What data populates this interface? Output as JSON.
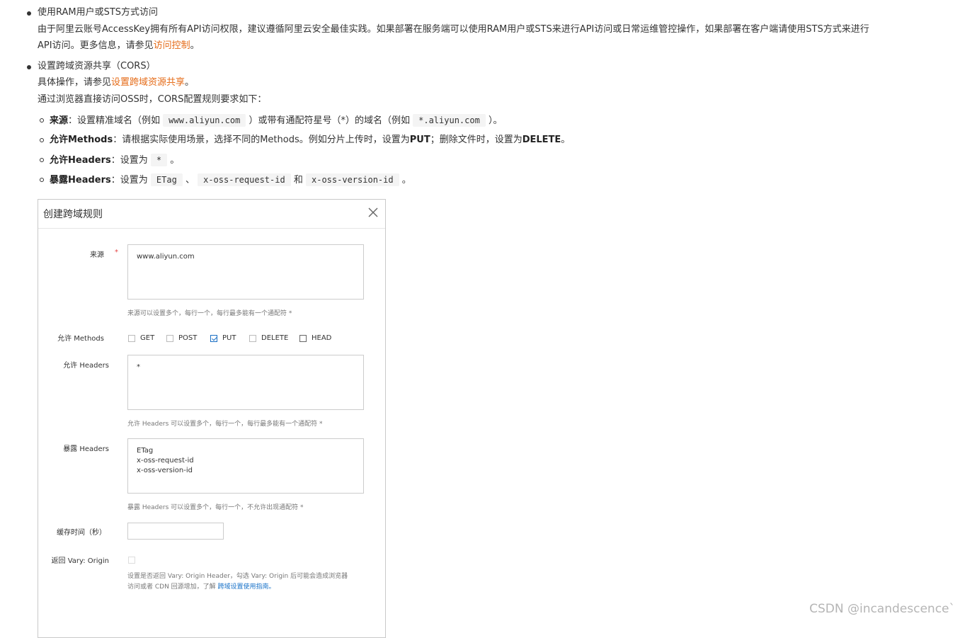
{
  "doc": {
    "item1": {
      "title": "使用RAM用户或STS方式访问",
      "line1": "由于阿里云账号AccessKey拥有所有API访问权限，建议遵循阿里云安全最佳实践。如果部署在服务端可以使用RAM用户或STS来进行API访问或日常运维管控操作，如果部署在客户端请使用STS方式来进行",
      "line2_prefix": "API访问。更多信息，请参见",
      "line2_link": "访问控制",
      "line2_suffix": "。"
    },
    "item2": {
      "title": "设置跨域资源共享（CORS）",
      "line1_prefix": "具体操作，请参见",
      "line1_link": "设置跨域资源共享",
      "line1_suffix": "。",
      "line2": "通过浏览器直接访问OSS时，CORS配置规则要求如下：",
      "rules": {
        "r1_label": "来源",
        "r1_text1": "：设置精准域名（例如",
        "r1_code1": "www.aliyun.com",
        "r1_text2": "）或带有通配符星号（*）的域名（例如",
        "r1_code2": "*.aliyun.com",
        "r1_text3": "）。",
        "r2_label": "允许Methods",
        "r2_text1": "：请根据实际使用场景，选择不同的Methods。例如分片上传时，设置为",
        "r2_b1": "PUT",
        "r2_text2": "；删除文件时，设置为",
        "r2_b2": "DELETE",
        "r2_text3": "。",
        "r3_label": "允许Headers",
        "r3_text1": "：设置为",
        "r3_code1": "*",
        "r3_text2": "。",
        "r4_label": "暴露Headers",
        "r4_text1": "：设置为",
        "r4_code1": "ETag",
        "r4_text2": "、",
        "r4_code2": "x-oss-request-id",
        "r4_text3": "和",
        "r4_code3": "x-oss-version-id",
        "r4_text4": "。"
      }
    }
  },
  "dialog": {
    "title": "创建跨域规则",
    "close_icon": "close-icon",
    "origin": {
      "label": "来源",
      "required": "*",
      "value": "www.aliyun.com",
      "hint": "来源可以设置多个，每行一个，每行最多能有一个通配符 *"
    },
    "methods": {
      "label": "允许 Methods",
      "options": [
        {
          "label": "GET",
          "checked": false
        },
        {
          "label": "POST",
          "checked": false
        },
        {
          "label": "PUT",
          "checked": true
        },
        {
          "label": "DELETE",
          "checked": false
        },
        {
          "label": "HEAD",
          "checked": false
        }
      ]
    },
    "allow_headers": {
      "label": "允许 Headers",
      "value": "*",
      "hint": "允许 Headers 可以设置多个，每行一个，每行最多能有一个通配符 *"
    },
    "expose_headers": {
      "label": "暴露 Headers",
      "value": "ETag\nx-oss-request-id\nx-oss-version-id",
      "hint": "暴露 Headers 可以设置多个，每行一个，不允许出现通配符 *"
    },
    "cache": {
      "label": "缓存时间（秒）",
      "value": ""
    },
    "vary": {
      "label": "返回 Vary: Origin",
      "checked": false,
      "hint_line1": "设置是否返回 Vary: Origin Header，勾选 Vary: Origin 后可能会造成浏览器",
      "hint_line2_prefix": "访问或者 CDN 回源增加，了解",
      "hint_line2_link": "跨域设置使用指南。"
    }
  },
  "watermark": "CSDN @incandescence`",
  "colors": {
    "link": "#e56b18",
    "checkbox_checked": "#1a6fc4",
    "required": "#e54545"
  }
}
